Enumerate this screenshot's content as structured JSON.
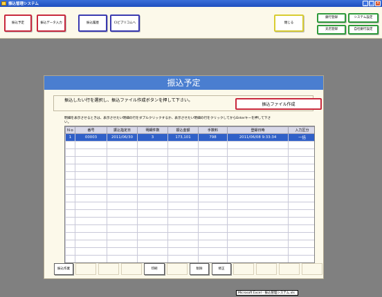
{
  "window": {
    "title": "振込管理システム",
    "controls": [
      "_",
      "□",
      "×"
    ]
  },
  "toolbar": {
    "buttons": [
      {
        "label": "振込予定",
        "color": "red"
      },
      {
        "label": "振込データ入力",
        "color": "red"
      },
      {
        "label": "振込履歴",
        "color": "blue"
      },
      {
        "label": "CIビプリコムへ",
        "color": "blue"
      },
      {
        "label": "閉じる",
        "color": "yellow"
      },
      {
        "label": "銀行登録",
        "color": "green"
      },
      {
        "label": "システム設定",
        "color": "green"
      },
      {
        "label": "支店登録",
        "color": "green"
      },
      {
        "label": "自社銀行設定",
        "color": "green"
      }
    ]
  },
  "panel": {
    "title": "振込予定",
    "instruction": "振込したい行を選択し、振込ファイル作成ボタンを押して下さい。",
    "create_button": "振込ファイル作成",
    "note": "明細を表示させるときは、表示させたい明細の行をダブルクリックするか、表示させたい明細の行をクリックしてからEnterキーを押して下さい。"
  },
  "table": {
    "headers": [
      "Ｎｏ",
      "番号",
      "振込指定日",
      "明細件数",
      "振込金額",
      "手数料",
      "登録日時",
      "入力区分"
    ],
    "rows": [
      [
        "1",
        "00003",
        "2011/06/30",
        "3",
        "173,101",
        "798",
        "2011/06/08 9:33:34",
        "一括"
      ]
    ]
  },
  "footer_buttons": [
    {
      "label": "振込作業",
      "active": true
    },
    {
      "label": "",
      "active": false
    },
    {
      "label": "",
      "active": false
    },
    {
      "label": "",
      "active": false
    },
    {
      "label": "印刷",
      "active": true
    },
    {
      "label": "",
      "active": false
    },
    {
      "label": "削除",
      "active": true
    },
    {
      "label": "修正",
      "active": true
    },
    {
      "label": "",
      "active": false
    },
    {
      "label": "",
      "active": false
    },
    {
      "label": "",
      "active": false
    },
    {
      "label": "",
      "active": false
    }
  ],
  "status": {
    "text": "Microsoft Excel - 振込管理システム.xls"
  }
}
